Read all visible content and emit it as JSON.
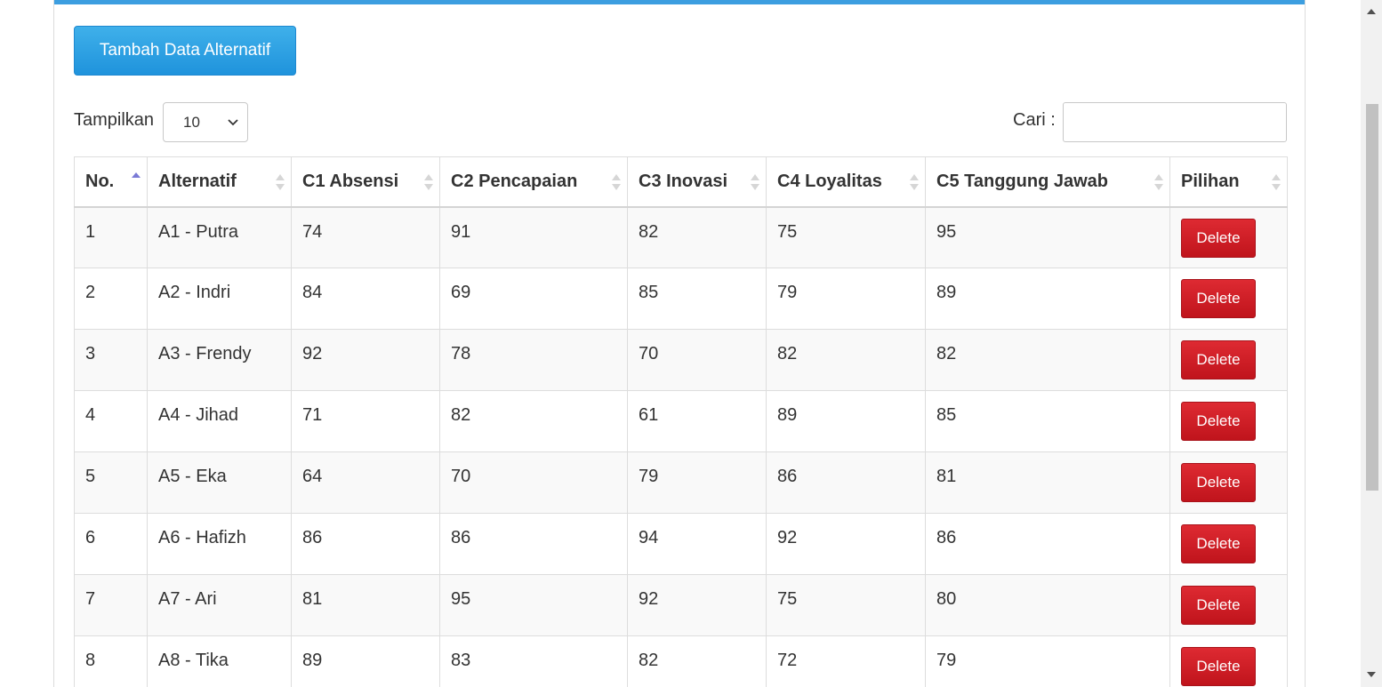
{
  "toolbar": {
    "add_label": "Tambah Data Alternatif"
  },
  "length_control": {
    "label": "Tampilkan",
    "selected": "10"
  },
  "search": {
    "label": "Cari :",
    "value": "",
    "placeholder": ""
  },
  "table": {
    "headers": [
      "No.",
      "Alternatif",
      "C1 Absensi",
      "C2 Pencapaian",
      "C3 Inovasi",
      "C4 Loyalitas",
      "C5 Tanggung Jawab",
      "Pilihan"
    ],
    "sorted_column": "No.",
    "sort_direction": "ascending",
    "delete_label": "Delete",
    "rows": [
      {
        "no": "1",
        "alt": "A1 - Putra",
        "c1": "74",
        "c2": "91",
        "c3": "82",
        "c4": "75",
        "c5": "95"
      },
      {
        "no": "2",
        "alt": "A2 - Indri",
        "c1": "84",
        "c2": "69",
        "c3": "85",
        "c4": "79",
        "c5": "89"
      },
      {
        "no": "3",
        "alt": "A3 - Frendy",
        "c1": "92",
        "c2": "78",
        "c3": "70",
        "c4": "82",
        "c5": "82"
      },
      {
        "no": "4",
        "alt": "A4 - Jihad",
        "c1": "71",
        "c2": "82",
        "c3": "61",
        "c4": "89",
        "c5": "85"
      },
      {
        "no": "5",
        "alt": "A5 - Eka",
        "c1": "64",
        "c2": "70",
        "c3": "79",
        "c4": "86",
        "c5": "81"
      },
      {
        "no": "6",
        "alt": "A6 - Hafizh",
        "c1": "86",
        "c2": "86",
        "c3": "94",
        "c4": "92",
        "c5": "86"
      },
      {
        "no": "7",
        "alt": "A7 - Ari",
        "c1": "81",
        "c2": "95",
        "c3": "92",
        "c4": "75",
        "c5": "80"
      },
      {
        "no": "8",
        "alt": "A8 - Tika",
        "c1": "89",
        "c2": "83",
        "c3": "82",
        "c4": "72",
        "c5": "79"
      }
    ]
  },
  "colors": {
    "accent": "#3c9ee0",
    "primary_button": "#2aa0e4",
    "danger_button": "#d01e26"
  },
  "icons": {
    "sort_asc": "sort-asc-icon",
    "sort_both": "sort-both-icon",
    "select_chevron": "chevron-down-icon"
  }
}
